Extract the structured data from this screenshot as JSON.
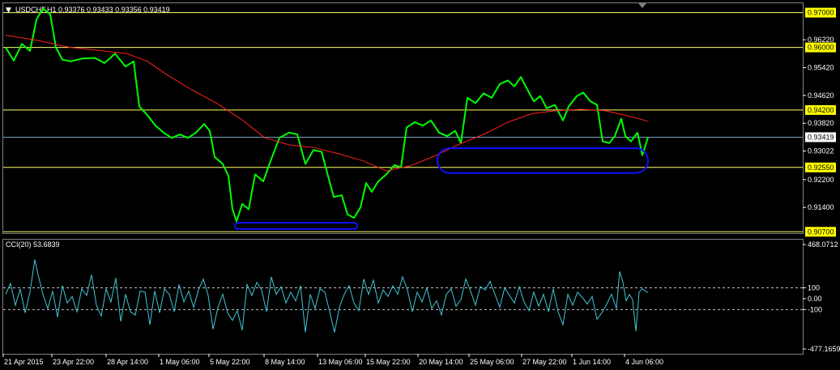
{
  "header": {
    "menu_glyph": "▼",
    "symbol_line": "USDCHF,H1  0.93376 0.93433 0.93356 0.93419"
  },
  "colors": {
    "background": "#000000",
    "price_line": "#00ff00",
    "moving_average": "#ff2020",
    "horizontal_levels": "#ffff66",
    "current_price_line": "#6fa0c0",
    "cci_line": "#40c8d8",
    "annotation_ellipses": "#1010ff",
    "axis_text": "#ffffff",
    "level_label_bg": "#ffff00"
  },
  "chart_data": [
    {
      "type": "line",
      "title": "USDCHF,H1",
      "ylim": [
        0.9066,
        0.9727
      ],
      "y_ticks": [
        "0.96220",
        "0.95420",
        "0.94620",
        "0.93820",
        "0.93022",
        "0.92200",
        "0.91400"
      ],
      "current_price": {
        "value": 0.93419,
        "label": "0.93419"
      },
      "horizontal_levels": [
        {
          "value": 0.97,
          "label": "0.97000"
        },
        {
          "value": 0.96,
          "label": "0.96000"
        },
        {
          "value": 0.942,
          "label": "0.94200"
        },
        {
          "value": 0.9255,
          "label": "0.92550"
        },
        {
          "value": 0.907,
          "label": "0.90700"
        }
      ],
      "x_tick_labels": [
        "21 Apr 2015",
        "23 Apr 22:00",
        "28 Apr 14:00",
        "1 May 06:00",
        "5 May 22:00",
        "8 May 14:00",
        "13 May 06:00",
        "15 May 22:00",
        "20 May 14:00",
        "25 May 06:00",
        "27 May 22:00",
        "1 Jun 14:00",
        "4 Jun 06:00"
      ],
      "series": [
        {
          "style": "price",
          "values": [
            [
              0,
              0.96
            ],
            [
              10,
              0.9562
            ],
            [
              20,
              0.961
            ],
            [
              30,
              0.959
            ],
            [
              38,
              0.968
            ],
            [
              46,
              0.9712
            ],
            [
              55,
              0.9695
            ],
            [
              62,
              0.96
            ],
            [
              70,
              0.9565
            ],
            [
              80,
              0.956
            ],
            [
              95,
              0.9568
            ],
            [
              110,
              0.957
            ],
            [
              122,
              0.9555
            ],
            [
              135,
              0.9582
            ],
            [
              148,
              0.9545
            ],
            [
              158,
              0.956
            ],
            [
              165,
              0.943
            ],
            [
              175,
              0.9405
            ],
            [
              185,
              0.9375
            ],
            [
              195,
              0.9355
            ],
            [
              205,
              0.934
            ],
            [
              215,
              0.935
            ],
            [
              225,
              0.934
            ],
            [
              235,
              0.9355
            ],
            [
              245,
              0.938
            ],
            [
              252,
              0.936
            ],
            [
              258,
              0.9285
            ],
            [
              268,
              0.9265
            ],
            [
              275,
              0.923
            ],
            [
              280,
              0.9135
            ],
            [
              285,
              0.91
            ],
            [
              292,
              0.915
            ],
            [
              300,
              0.9135
            ],
            [
              308,
              0.9235
            ],
            [
              318,
              0.9215
            ],
            [
              328,
              0.928
            ],
            [
              338,
              0.934
            ],
            [
              350,
              0.9355
            ],
            [
              360,
              0.935
            ],
            [
              370,
              0.9265
            ],
            [
              380,
              0.9305
            ],
            [
              390,
              0.93
            ],
            [
              398,
              0.923
            ],
            [
              405,
              0.917
            ],
            [
              415,
              0.9175
            ],
            [
              422,
              0.912
            ],
            [
              430,
              0.911
            ],
            [
              438,
              0.914
            ],
            [
              445,
              0.921
            ],
            [
              452,
              0.9185
            ],
            [
              460,
              0.9215
            ],
            [
              470,
              0.9235
            ],
            [
              480,
              0.9262
            ],
            [
              488,
              0.9255
            ],
            [
              495,
              0.937
            ],
            [
              505,
              0.9385
            ],
            [
              515,
              0.9375
            ],
            [
              525,
              0.939
            ],
            [
              535,
              0.9355
            ],
            [
              545,
              0.9345
            ],
            [
              555,
              0.936
            ],
            [
              562,
              0.9325
            ],
            [
              570,
              0.9455
            ],
            [
              580,
              0.944
            ],
            [
              590,
              0.9468
            ],
            [
              600,
              0.9455
            ],
            [
              610,
              0.9495
            ],
            [
              620,
              0.9505
            ],
            [
              628,
              0.9488
            ],
            [
              636,
              0.9515
            ],
            [
              645,
              0.9475
            ],
            [
              652,
              0.9445
            ],
            [
              660,
              0.946
            ],
            [
              668,
              0.9425
            ],
            [
              678,
              0.9435
            ],
            [
              688,
              0.939
            ],
            [
              695,
              0.943
            ],
            [
              705,
              0.946
            ],
            [
              713,
              0.947
            ],
            [
              722,
              0.9445
            ],
            [
              730,
              0.9435
            ],
            [
              737,
              0.933
            ],
            [
              745,
              0.9325
            ],
            [
              752,
              0.9345
            ],
            [
              760,
              0.9395
            ],
            [
              765,
              0.9345
            ],
            [
              772,
              0.933
            ],
            [
              780,
              0.9355
            ],
            [
              786,
              0.929
            ],
            [
              793,
              0.9342
            ]
          ]
        },
        {
          "style": "moving_average",
          "values": [
            [
              0,
              0.9635
            ],
            [
              40,
              0.962
            ],
            [
              80,
              0.96
            ],
            [
              120,
              0.959
            ],
            [
              150,
              0.9582
            ],
            [
              175,
              0.956
            ],
            [
              200,
              0.952
            ],
            [
              230,
              0.9478
            ],
            [
              260,
              0.944
            ],
            [
              290,
              0.9395
            ],
            [
              320,
              0.934
            ],
            [
              350,
              0.932
            ],
            [
              380,
              0.9312
            ],
            [
              410,
              0.9295
            ],
            [
              440,
              0.9275
            ],
            [
              470,
              0.9245
            ],
            [
              500,
              0.926
            ],
            [
              530,
              0.9288
            ],
            [
              560,
              0.9322
            ],
            [
              590,
              0.935
            ],
            [
              620,
              0.9385
            ],
            [
              650,
              0.941
            ],
            [
              680,
              0.9418
            ],
            [
              710,
              0.9422
            ],
            [
              740,
              0.9418
            ],
            [
              770,
              0.9402
            ],
            [
              793,
              0.9388
            ]
          ]
        }
      ],
      "annotations": [
        {
          "shape": "rounded-rect",
          "x_range": [
            283,
            434
          ],
          "y_range": [
            0.9078,
            0.9096
          ]
        },
        {
          "shape": "rounded-rect",
          "x_range": [
            533,
            793
          ],
          "y_range": [
            0.9239,
            0.931
          ]
        }
      ]
    },
    {
      "type": "line",
      "title": "CCI(20) 53.6839",
      "ylim": [
        -477.1659,
        468.0712
      ],
      "y_ticks": [
        "468.0712",
        "100",
        "0.00",
        "-100",
        "-477.1659"
      ],
      "levels": [
        100,
        -100
      ],
      "series": [
        {
          "style": "cci",
          "values": [
            [
              0,
              40
            ],
            [
              6,
              140
            ],
            [
              12,
              -60
            ],
            [
              18,
              90
            ],
            [
              24,
              -130
            ],
            [
              30,
              60
            ],
            [
              36,
              360
            ],
            [
              40,
              220
            ],
            [
              46,
              40
            ],
            [
              52,
              -90
            ],
            [
              58,
              70
            ],
            [
              64,
              -170
            ],
            [
              70,
              120
            ],
            [
              76,
              -40
            ],
            [
              82,
              20
            ],
            [
              88,
              -120
            ],
            [
              94,
              90
            ],
            [
              100,
              30
            ],
            [
              106,
              220
            ],
            [
              112,
              -60
            ],
            [
              118,
              -160
            ],
            [
              124,
              90
            ],
            [
              130,
              -30
            ],
            [
              136,
              190
            ],
            [
              142,
              -210
            ],
            [
              148,
              40
            ],
            [
              154,
              -120
            ],
            [
              160,
              -150
            ],
            [
              166,
              70
            ],
            [
              172,
              60
            ],
            [
              178,
              -240
            ],
            [
              184,
              70
            ],
            [
              190,
              -130
            ],
            [
              196,
              90
            ],
            [
              202,
              40
            ],
            [
              208,
              -120
            ],
            [
              214,
              130
            ],
            [
              220,
              -30
            ],
            [
              226,
              70
            ],
            [
              232,
              -80
            ],
            [
              238,
              80
            ],
            [
              244,
              180
            ],
            [
              250,
              30
            ],
            [
              256,
              -280
            ],
            [
              262,
              -80
            ],
            [
              268,
              40
            ],
            [
              274,
              -130
            ],
            [
              280,
              -200
            ],
            [
              286,
              -110
            ],
            [
              292,
              -290
            ],
            [
              298,
              130
            ],
            [
              304,
              30
            ],
            [
              310,
              150
            ],
            [
              316,
              80
            ],
            [
              322,
              -120
            ],
            [
              328,
              200
            ],
            [
              334,
              40
            ],
            [
              340,
              110
            ],
            [
              346,
              -40
            ],
            [
              352,
              60
            ],
            [
              358,
              -20
            ],
            [
              364,
              120
            ],
            [
              370,
              -310
            ],
            [
              376,
              40
            ],
            [
              382,
              -90
            ],
            [
              388,
              90
            ],
            [
              394,
              60
            ],
            [
              400,
              -120
            ],
            [
              406,
              -310
            ],
            [
              412,
              -80
            ],
            [
              418,
              40
            ],
            [
              424,
              120
            ],
            [
              430,
              -40
            ],
            [
              436,
              -110
            ],
            [
              442,
              180
            ],
            [
              448,
              40
            ],
            [
              454,
              170
            ],
            [
              460,
              -40
            ],
            [
              466,
              80
            ],
            [
              472,
              20
            ],
            [
              478,
              120
            ],
            [
              484,
              40
            ],
            [
              490,
              200
            ],
            [
              496,
              80
            ],
            [
              502,
              -120
            ],
            [
              508,
              60
            ],
            [
              514,
              -30
            ],
            [
              520,
              100
            ],
            [
              526,
              -90
            ],
            [
              532,
              -20
            ],
            [
              538,
              -150
            ],
            [
              544,
              40
            ],
            [
              550,
              90
            ],
            [
              556,
              -70
            ],
            [
              562,
              -10
            ],
            [
              568,
              180
            ],
            [
              574,
              70
            ],
            [
              580,
              -60
            ],
            [
              586,
              110
            ],
            [
              592,
              80
            ],
            [
              598,
              160
            ],
            [
              604,
              40
            ],
            [
              610,
              -80
            ],
            [
              616,
              100
            ],
            [
              622,
              30
            ],
            [
              628,
              -40
            ],
            [
              634,
              110
            ],
            [
              640,
              -30
            ],
            [
              646,
              -110
            ],
            [
              652,
              60
            ],
            [
              658,
              -70
            ],
            [
              664,
              40
            ],
            [
              670,
              -120
            ],
            [
              676,
              90
            ],
            [
              682,
              -120
            ],
            [
              688,
              -240
            ],
            [
              694,
              40
            ],
            [
              700,
              -60
            ],
            [
              706,
              60
            ],
            [
              712,
              10
            ],
            [
              718,
              -50
            ],
            [
              724,
              20
            ],
            [
              730,
              -190
            ],
            [
              736,
              -130
            ],
            [
              742,
              -50
            ],
            [
              748,
              40
            ],
            [
              754,
              -90
            ],
            [
              758,
              250
            ],
            [
              762,
              150
            ],
            [
              766,
              -20
            ],
            [
              770,
              40
            ],
            [
              774,
              -10
            ],
            [
              778,
              -300
            ],
            [
              782,
              60
            ],
            [
              786,
              90
            ],
            [
              793,
              54
            ]
          ]
        }
      ]
    }
  ]
}
